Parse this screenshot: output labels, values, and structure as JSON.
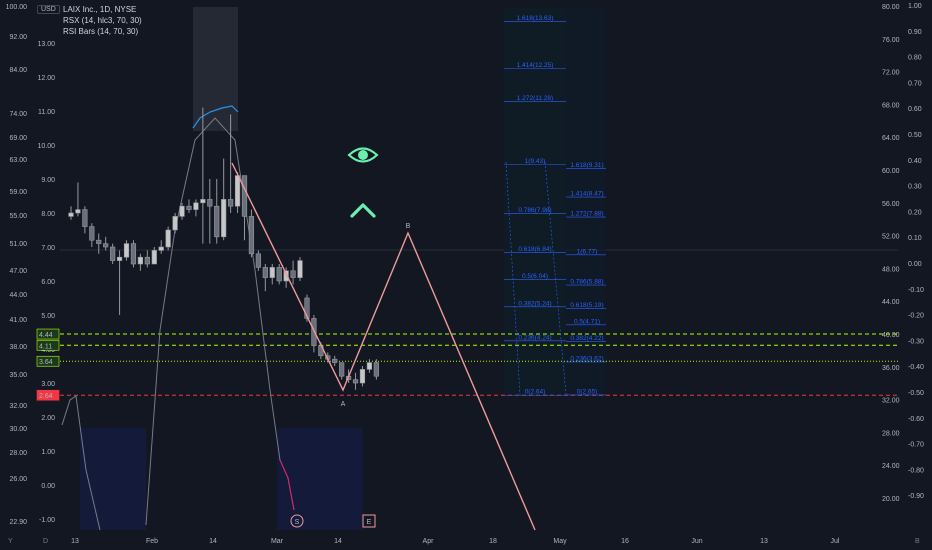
{
  "legend": {
    "title": "LAIX Inc., 1D, NYSE",
    "line2": "RSX (14, hlc3, 70, 30)",
    "line3": "RSI Bars (14, 70, 30)"
  },
  "currency_label": "USD",
  "corner_labels": {
    "bottom_left": "Y",
    "bottom_left2": "D",
    "bottom_right": "B"
  },
  "colors": {
    "background": "#131722",
    "candle_fill": "#c7c7c7",
    "candle_stroke": "#9598a1",
    "rsx_line": "#2196f3",
    "indicator_line": "#787b86",
    "indicator_low": "#e91e63",
    "pattern_line": "#ef9a9a",
    "fib_text": "#2962ff",
    "green_level": "#b4ff00",
    "red_level": "#f23645",
    "eye_icon": "#69f0ae"
  },
  "chart_data": {
    "type": "candlestick",
    "x_ticks": [
      "13",
      "Feb",
      "14",
      "Mar",
      "14",
      "Apr",
      "18",
      "May",
      "16",
      "Jun",
      "13",
      "Jul"
    ],
    "price_ticks_left": [
      "100.00",
      "92.00",
      "84.00",
      "74.00",
      "69.00",
      "63.00",
      "59.00",
      "55.00",
      "51.00",
      "47.00",
      "44.00",
      "41.00",
      "38.00",
      "35.00",
      "32.00",
      "30.00",
      "28.00",
      "26.00",
      "22.90"
    ],
    "price_ticks_inner": [
      "13.00",
      "12.00",
      "11.00",
      "10.00",
      "9.00",
      "8.00",
      "7.00",
      "6.00",
      "5.00",
      "4.00",
      "3.00",
      "2.00",
      "1.00",
      "0.00",
      "-1.00"
    ],
    "right_ticks_outer": [
      "80.00",
      "76.00",
      "72.00",
      "68.00",
      "64.00",
      "60.00",
      "56.00",
      "52.00",
      "48.00",
      "44.00",
      "40.00",
      "36.00",
      "32.00",
      "28.00",
      "24.00",
      "20.00"
    ],
    "right_ticks_inner": [
      "1.00",
      "0.90",
      "0.80",
      "0.70",
      "0.60",
      "0.50",
      "0.40",
      "0.30",
      "0.20",
      "0.10",
      "0.00",
      "-0.10",
      "-0.20",
      "-0.30",
      "-0.40",
      "-0.50",
      "-0.60",
      "-0.70",
      "-0.80",
      "-0.90"
    ],
    "price_range": [
      1.62,
      13.6
    ],
    "candles": [
      [
        7.9,
        8.2,
        7.8,
        8.0
      ],
      [
        8.0,
        8.9,
        7.9,
        8.1
      ],
      [
        8.1,
        8.2,
        7.4,
        7.6
      ],
      [
        7.6,
        7.7,
        7.0,
        7.2
      ],
      [
        7.2,
        7.4,
        6.8,
        7.1
      ],
      [
        7.1,
        7.3,
        6.9,
        7.0
      ],
      [
        7.0,
        7.1,
        6.5,
        6.6
      ],
      [
        6.6,
        6.9,
        5.0,
        6.7
      ],
      [
        6.7,
        7.2,
        6.6,
        7.1
      ],
      [
        7.1,
        7.2,
        6.4,
        6.5
      ],
      [
        6.5,
        6.8,
        6.3,
        6.7
      ],
      [
        6.7,
        6.9,
        6.4,
        6.5
      ],
      [
        6.5,
        7.0,
        6.5,
        6.9
      ],
      [
        6.9,
        7.2,
        6.8,
        7.0
      ],
      [
        7.0,
        7.6,
        6.9,
        7.5
      ],
      [
        7.5,
        8.0,
        7.4,
        7.9
      ],
      [
        7.9,
        8.3,
        7.8,
        8.2
      ],
      [
        8.2,
        8.4,
        8.0,
        8.1
      ],
      [
        8.1,
        8.4,
        7.9,
        8.3
      ],
      [
        8.3,
        11.1,
        7.1,
        8.4
      ],
      [
        8.4,
        9.0,
        7.1,
        8.2
      ],
      [
        8.2,
        9.0,
        7.1,
        7.3
      ],
      [
        7.3,
        9.6,
        7.2,
        8.4
      ],
      [
        8.4,
        10.9,
        8.0,
        8.2
      ],
      [
        8.2,
        9.2,
        8.0,
        9.1
      ],
      [
        9.1,
        9.1,
        7.2,
        7.9
      ],
      [
        7.9,
        8.1,
        6.7,
        6.8
      ],
      [
        6.8,
        6.9,
        6.3,
        6.4
      ],
      [
        6.4,
        6.5,
        5.7,
        6.1
      ],
      [
        6.1,
        6.5,
        5.9,
        6.4
      ],
      [
        6.4,
        6.5,
        5.9,
        6.0
      ],
      [
        6.0,
        6.4,
        5.8,
        6.3
      ],
      [
        6.3,
        6.6,
        5.9,
        6.1
      ],
      [
        6.1,
        6.7,
        6.0,
        6.6
      ],
      [
        5.5,
        5.6,
        4.8,
        4.9
      ],
      [
        4.9,
        5.0,
        3.9,
        4.1
      ],
      [
        4.1,
        4.2,
        3.7,
        3.8
      ],
      [
        3.8,
        3.9,
        3.6,
        3.7
      ],
      [
        3.7,
        3.8,
        3.5,
        3.6
      ],
      [
        3.6,
        3.6,
        3.1,
        3.2
      ],
      [
        3.2,
        3.4,
        3.0,
        3.1
      ],
      [
        3.1,
        3.3,
        2.8,
        3.0
      ],
      [
        3.0,
        3.5,
        2.9,
        3.4
      ],
      [
        3.4,
        3.7,
        3.3,
        3.6
      ],
      [
        3.6,
        3.7,
        3.1,
        3.2
      ]
    ],
    "price_axis_tags": [
      {
        "label": "4.44",
        "value": 4.44,
        "color": "#b4ff00",
        "style": "dashed"
      },
      {
        "label": "4.11",
        "value": 4.11,
        "color": "#b4ff00",
        "style": "dashed"
      },
      {
        "label": "3.64",
        "value": 3.64,
        "color": "#b4ff00",
        "style": "dotted"
      },
      {
        "label": "2.64",
        "value": 2.64,
        "color": "#f23645",
        "style": "dashed"
      }
    ],
    "pattern_points": [
      {
        "label": "",
        "day": 24,
        "price": 9.43
      },
      {
        "label": "A",
        "day": 41,
        "price": 2.64
      },
      {
        "label": "B",
        "day": 49,
        "price": 7.65
      },
      {
        "label": "",
        "day": 67,
        "price": 0.0
      }
    ],
    "fib_left": [
      {
        "label": "1.618(13.63)",
        "price": 13.63
      },
      {
        "label": "1.414(12.25)",
        "price": 12.25
      },
      {
        "label": "1.272(11.28)",
        "price": 11.28
      },
      {
        "label": "1(9.43)",
        "price": 9.43
      },
      {
        "label": "0.786(7.98)",
        "price": 7.98
      },
      {
        "label": "0.618(6.84)",
        "price": 6.84
      },
      {
        "label": "0.5(6.04)",
        "price": 6.04
      },
      {
        "label": "0.382(5.24)",
        "price": 5.24
      },
      {
        "label": "0.236(4.24)",
        "price": 4.24
      },
      {
        "label": "0(2.64)",
        "price": 2.64
      }
    ],
    "fib_right": [
      {
        "label": "1.618(9.31)",
        "price": 9.31
      },
      {
        "label": "1.414(8.47)",
        "price": 8.47
      },
      {
        "label": "1.272(7.88)",
        "price": 7.88
      },
      {
        "label": "1(6.77)",
        "price": 6.77
      },
      {
        "label": "0.786(5.88)",
        "price": 5.88
      },
      {
        "label": "0.618(5.19)",
        "price": 5.19
      },
      {
        "label": "0.5(4.71)",
        "price": 4.71
      },
      {
        "label": "0.382(4.22)",
        "price": 4.22
      },
      {
        "label": "0.236(3.62)",
        "price": 3.62
      },
      {
        "label": "0(2.65)",
        "price": 2.65
      }
    ],
    "markers": [
      {
        "label": "S",
        "day": 34,
        "color": "#ef9a9a"
      },
      {
        "label": "E",
        "day": 43,
        "color": "#ef9a9a"
      }
    ],
    "icons": [
      "eye-icon",
      "chevron-up-icon"
    ]
  }
}
